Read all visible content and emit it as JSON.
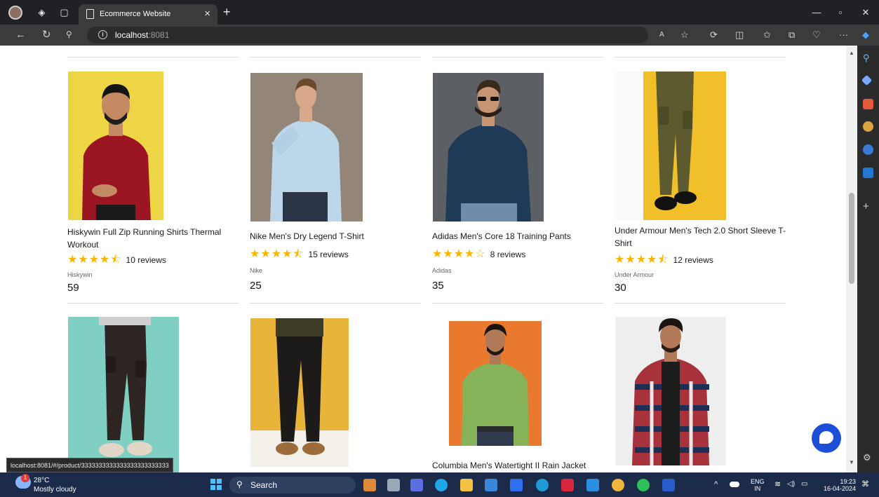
{
  "browser": {
    "tab_title": "Ecommerce Website",
    "tab_close": "×",
    "new_tab": "+",
    "url_host": "localhost",
    "url_port": ":8081",
    "status_url": "localhost:8081/#/product/3333333333333333333333333"
  },
  "products": [
    {
      "title": "Hiskywin Full Zip Running Shirts Thermal Workout",
      "rating": 4.5,
      "reviews": "10 reviews",
      "brand": "Hiskywin",
      "price": "59",
      "image": "maroon-shirt-man"
    },
    {
      "title": "Nike Men's Dry Legend T-Shirt",
      "rating": 4.5,
      "reviews": "15 reviews",
      "brand": "Nike",
      "price": "25",
      "image": "light-blue-shirt-man"
    },
    {
      "title": "Adidas Men's Core 18 Training Pants",
      "rating": 4,
      "reviews": "8 reviews",
      "brand": "Adidas",
      "price": "35",
      "image": "denim-shirt-man"
    },
    {
      "title": "Under Armour Men's Tech 2.0 Short Sleeve T-Shirt",
      "rating": 4.5,
      "reviews": "12 reviews",
      "brand": "Under Armour",
      "price": "30",
      "image": "olive-cargo-pants"
    },
    {
      "title": "",
      "image": "dark-cargo-pants"
    },
    {
      "title": "",
      "image": "black-cargo-pants"
    },
    {
      "title": "Columbia Men's Watertight II Rain Jacket",
      "image": "green-shirt-man"
    },
    {
      "title": "",
      "image": "plaid-shirt-man"
    }
  ],
  "taskbar": {
    "temperature": "28°C",
    "weather": "Mostly cloudy",
    "weather_badge": "1",
    "search_label": "Search",
    "lang_top": "ENG",
    "lang_bottom": "IN",
    "time": "19:23",
    "date": "16-04-2024"
  },
  "colors": {
    "star": "#f7b500",
    "chat_button": "#1d4ed8"
  }
}
